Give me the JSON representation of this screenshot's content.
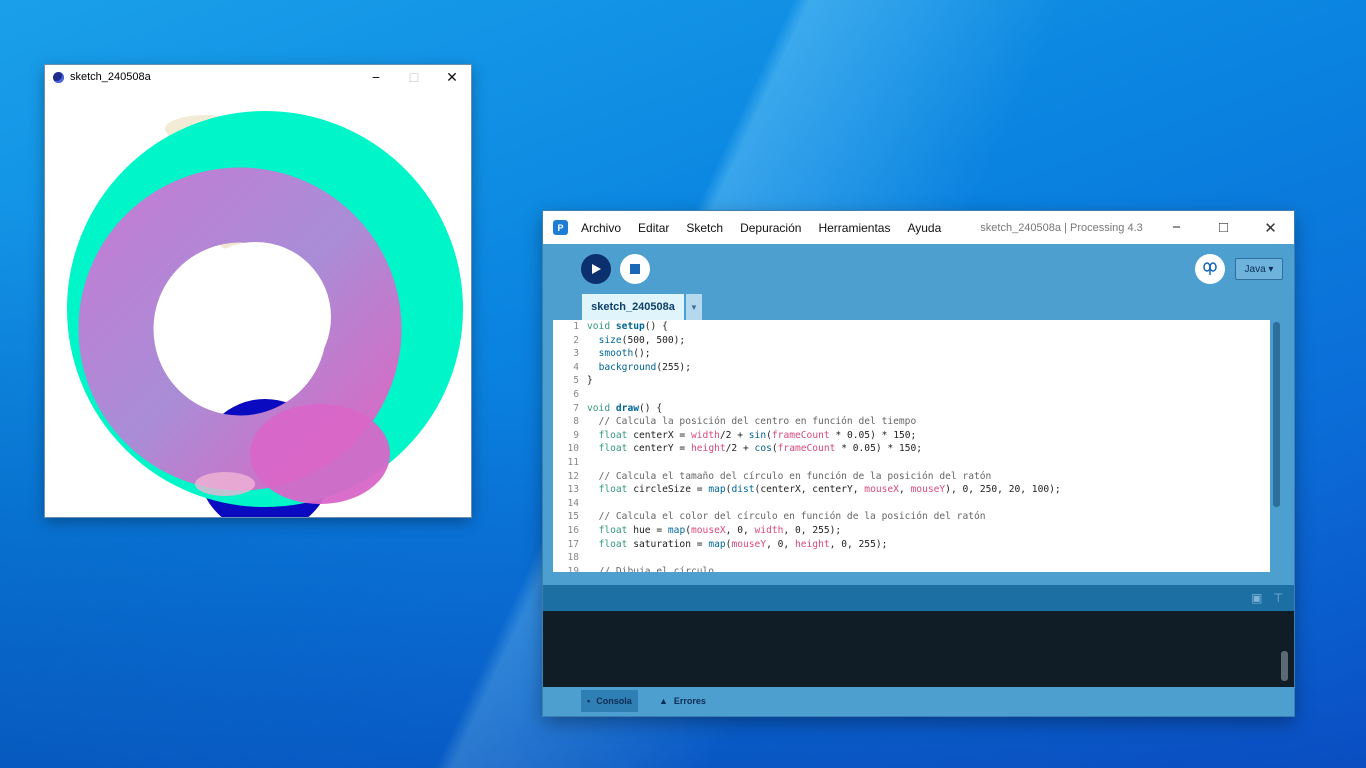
{
  "sketch_window": {
    "title": "sketch_240508a",
    "controls": {
      "minimize": "−",
      "maximize": "□",
      "close": "✕"
    }
  },
  "ide": {
    "title": "sketch_240508a | Processing 4.3",
    "menu": [
      "Archivo",
      "Editar",
      "Sketch",
      "Depuración",
      "Herramientas",
      "Ayuda"
    ],
    "controls": {
      "minimize": "−",
      "maximize": "□",
      "close": "✕"
    },
    "mode": "Java ▾",
    "tab": "sketch_240508a",
    "tab_menu": "▼",
    "code_lines": [
      "void setup() {",
      "  size(500, 500);",
      "  smooth();",
      "  background(255);",
      "}",
      "",
      "void draw() {",
      "  // Calcula la posición del centro en función del tiempo",
      "  float centerX = width/2 + sin(frameCount * 0.05) * 150;",
      "  float centerY = height/2 + cos(frameCount * 0.05) * 150;",
      "",
      "  // Calcula el tamaño del círculo en función de la posición del ratón",
      "  float circleSize = map(dist(centerX, centerY, mouseX, mouseY), 0, 250, 20, 100);",
      "",
      "  // Calcula el color del círculo en función de la posición del ratón",
      "  float hue = map(mouseX, 0, width, 0, 255);",
      "  float saturation = map(mouseY, 0, height, 0, 255);",
      "",
      "  // Dibuja el círculo"
    ],
    "console_tabs": [
      {
        "label": "Consola",
        "icon": "terminal-icon"
      },
      {
        "label": "Errores",
        "icon": "warning-icon"
      }
    ]
  },
  "colors": {
    "teal": "#00f5c8",
    "lavender": "#b87fd0",
    "pink": "#d870c8",
    "blue": "#0a0ac0"
  }
}
